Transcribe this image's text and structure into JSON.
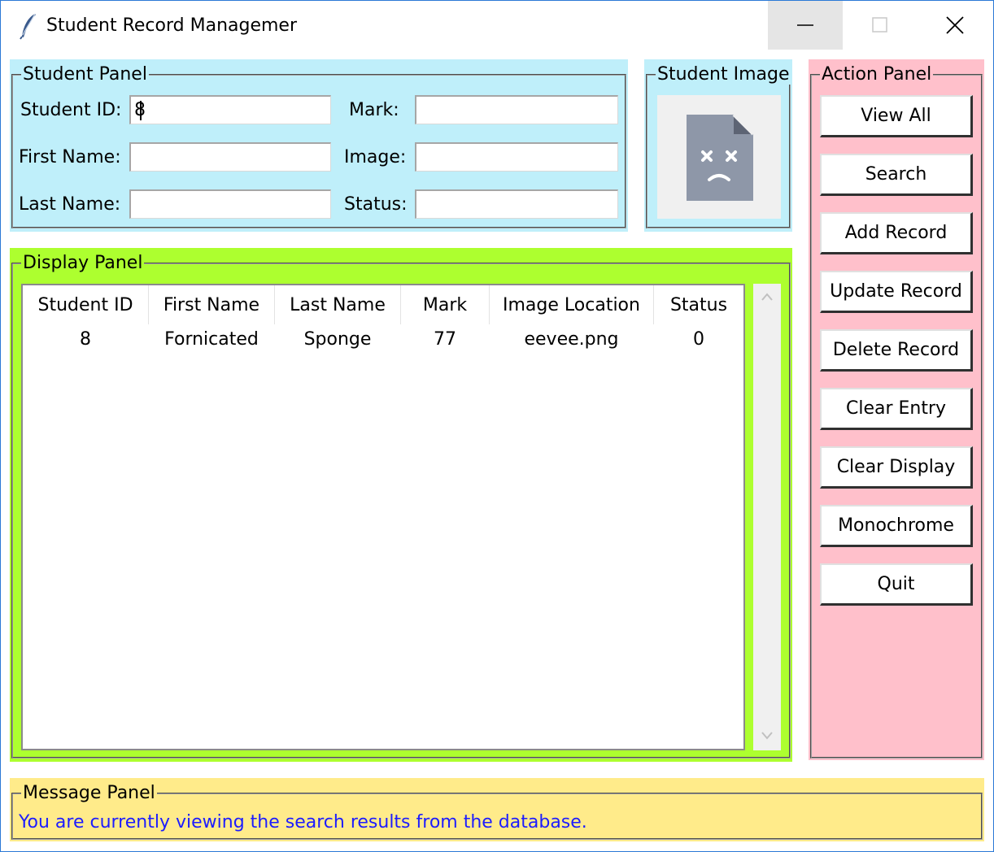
{
  "window": {
    "title": "Student Record Managemer"
  },
  "student_panel": {
    "legend": "Student Panel",
    "labels": {
      "student_id": "Student ID:",
      "first_name": "First Name:",
      "last_name": "Last Name:",
      "mark": "Mark:",
      "image": "Image:",
      "status": "Status:"
    },
    "values": {
      "student_id": "8",
      "first_name": "",
      "last_name": "",
      "mark": "",
      "image": "",
      "status": ""
    }
  },
  "image_panel": {
    "legend": "Student Image",
    "icon": "broken-file-sad-face-icon"
  },
  "action_panel": {
    "legend": "Action Panel",
    "buttons": [
      "View All",
      "Search",
      "Add Record",
      "Update Record",
      "Delete Record",
      "Clear Entry",
      "Clear Display",
      "Monochrome",
      "Quit"
    ]
  },
  "display_panel": {
    "legend": "Display Panel",
    "columns": [
      "Student ID",
      "First Name",
      "Last Name",
      "Mark",
      "Image Location",
      "Status"
    ],
    "rows": [
      [
        "8",
        "Fornicated",
        "Sponge",
        "77",
        "eevee.png",
        "0"
      ]
    ]
  },
  "message_panel": {
    "legend": "Message Panel",
    "text": "You are currently viewing the search results from the database."
  },
  "colors": {
    "student_panel_bg": "#bfeffa",
    "image_panel_bg": "#bfeffa",
    "action_panel_bg": "#ffc0cb",
    "display_panel_bg": "#adff2f",
    "message_panel_bg": "#ffeb8a",
    "message_text": "#1c1cff"
  }
}
